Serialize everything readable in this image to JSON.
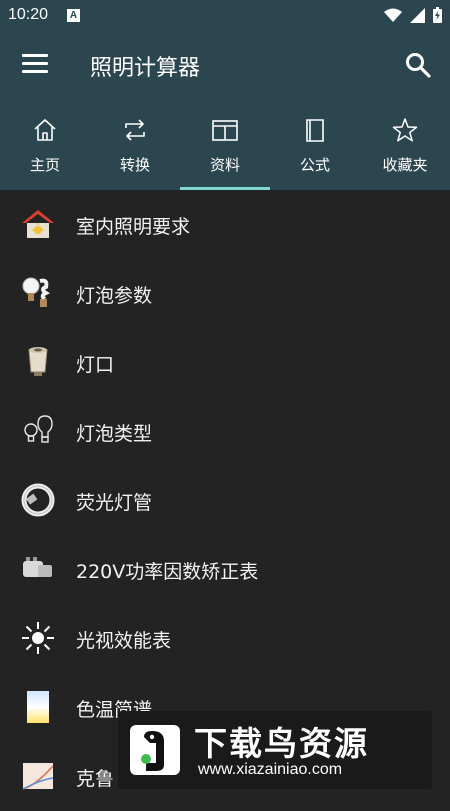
{
  "status": {
    "time": "10:20",
    "notification_icon": "a-notification-icon",
    "icons": [
      "wifi-icon",
      "signal-icon",
      "battery-icon"
    ]
  },
  "appbar": {
    "title": "照明计算器",
    "menu_icon": "menu-icon",
    "search_icon": "search-icon"
  },
  "tabs": [
    {
      "label": "主页",
      "icon": "home-icon"
    },
    {
      "label": "转换",
      "icon": "convert-icon"
    },
    {
      "label": "资料",
      "icon": "book-open-icon",
      "active": true
    },
    {
      "label": "公式",
      "icon": "book-icon"
    },
    {
      "label": "收藏夹",
      "icon": "star-icon"
    }
  ],
  "list": {
    "items": [
      {
        "label": "室内照明要求",
        "icon": "house-icon"
      },
      {
        "label": "灯泡参数",
        "icon": "bulbs-icon"
      },
      {
        "label": "灯口",
        "icon": "lamp-socket-icon"
      },
      {
        "label": "灯泡类型",
        "icon": "bulb-outline-icon"
      },
      {
        "label": "荧光灯管",
        "icon": "fluorescent-ring-icon"
      },
      {
        "label": "220V功率因数矫正表",
        "icon": "capacitor-icon"
      },
      {
        "label": "光视效能表",
        "icon": "sun-icon"
      },
      {
        "label": "色温简谱",
        "icon": "color-temperature-icon"
      },
      {
        "label": "克鲁",
        "icon": "kruithof-chart-icon"
      }
    ]
  },
  "watermark": {
    "title": "下载鸟资源",
    "url": "www.xiazainiao.com",
    "icon": "bird-logo-icon"
  },
  "colors": {
    "header": "#2c4650",
    "background": "#232323",
    "accent": "#7fd8cf"
  }
}
